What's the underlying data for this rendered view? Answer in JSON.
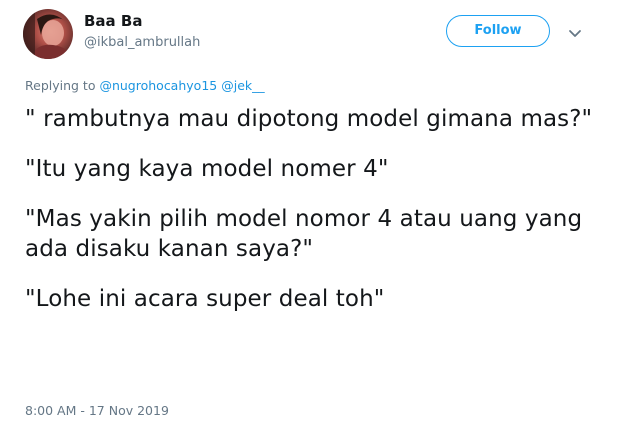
{
  "author": {
    "display_name": "Baa Ba",
    "handle": "@ikbal_ambrullah"
  },
  "actions": {
    "follow_label": "Follow",
    "more_icon": "chevron-down-icon"
  },
  "reply_context": {
    "prefix": "Replying to ",
    "mentions": [
      "@nugrohocahyo15",
      "@jek__"
    ]
  },
  "tweet": {
    "paragraphs": [
      "\" rambutnya mau dipotong model gimana mas?\"",
      "\"Itu yang kaya model nomer 4\"",
      "\"Mas yakin pilih model nomor 4 atau uang yang ada disaku kanan saya?\"",
      "\"Lohe ini acara super deal toh\""
    ],
    "timestamp": "8:00 AM - 17 Nov 2019"
  },
  "colors": {
    "accent": "#1da1f2",
    "mention": "#1b95e0",
    "secondary_text": "#657786",
    "primary_text": "#14171a"
  }
}
